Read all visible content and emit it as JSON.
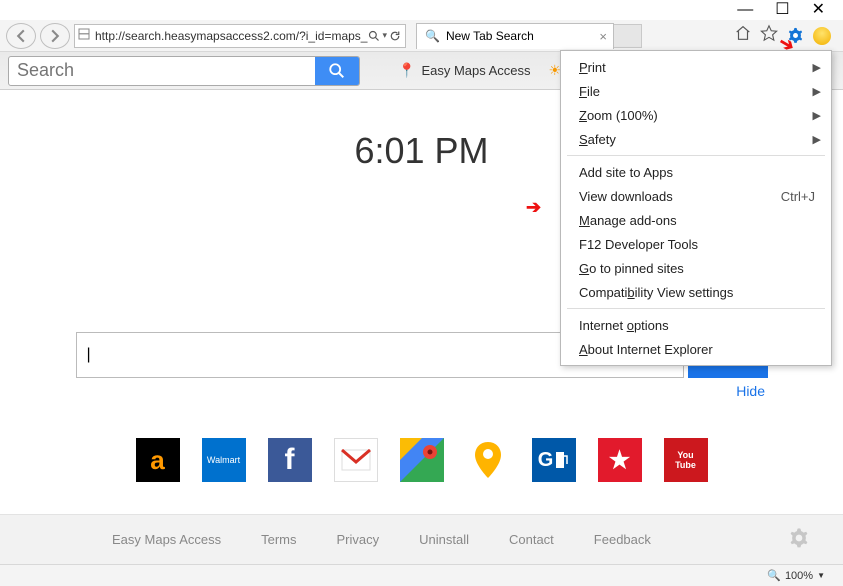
{
  "window_controls": {
    "min": "—",
    "max": "☐",
    "close": "✕"
  },
  "address_bar": {
    "url": "http://search.heasymapsaccess2.com/?i_id=maps_",
    "search_glyph": "🔍"
  },
  "tab": {
    "title": "New Tab Search",
    "icon": "•"
  },
  "icons": {
    "home": "⌂",
    "star": "☆",
    "smile": ":)"
  },
  "toolbar": {
    "search_placeholder": "Search",
    "brand": "Easy Maps Access",
    "brand_icon": "🧭"
  },
  "page": {
    "clock": "6:01 PM",
    "big_search_value": "",
    "hide": "Hide",
    "tiles": [
      {
        "id": "amazon",
        "label": "a"
      },
      {
        "id": "walmart",
        "label": "Walmart"
      },
      {
        "id": "facebook",
        "label": "f"
      },
      {
        "id": "gmail",
        "label": "M"
      },
      {
        "id": "gmaps",
        "label": ""
      },
      {
        "id": "ymaps",
        "label": ""
      },
      {
        "id": "gasbuddy",
        "label": "G"
      },
      {
        "id": "macys",
        "label": "★"
      },
      {
        "id": "youtube",
        "label": "You\nTube"
      }
    ]
  },
  "footer": {
    "links": [
      "Easy Maps Access",
      "Terms",
      "Privacy",
      "Uninstall",
      "Contact",
      "Feedback"
    ]
  },
  "status": {
    "zoom": "100%"
  },
  "menu": {
    "items_top": [
      {
        "label": "Print",
        "chev": true
      },
      {
        "label": "File",
        "chev": true
      },
      {
        "label": "Zoom (100%)",
        "chev": true
      },
      {
        "label": "Safety",
        "chev": true
      }
    ],
    "items_mid": [
      {
        "label": "Add site to Apps"
      },
      {
        "label": "View downloads",
        "shortcut": "Ctrl+J"
      },
      {
        "label": "Manage add-ons"
      },
      {
        "label": "F12 Developer Tools"
      },
      {
        "label": "Go to pinned sites"
      },
      {
        "label": "Compatibility View settings"
      }
    ],
    "items_bot": [
      {
        "label": "Internet options"
      },
      {
        "label": "About Internet Explorer"
      }
    ]
  }
}
